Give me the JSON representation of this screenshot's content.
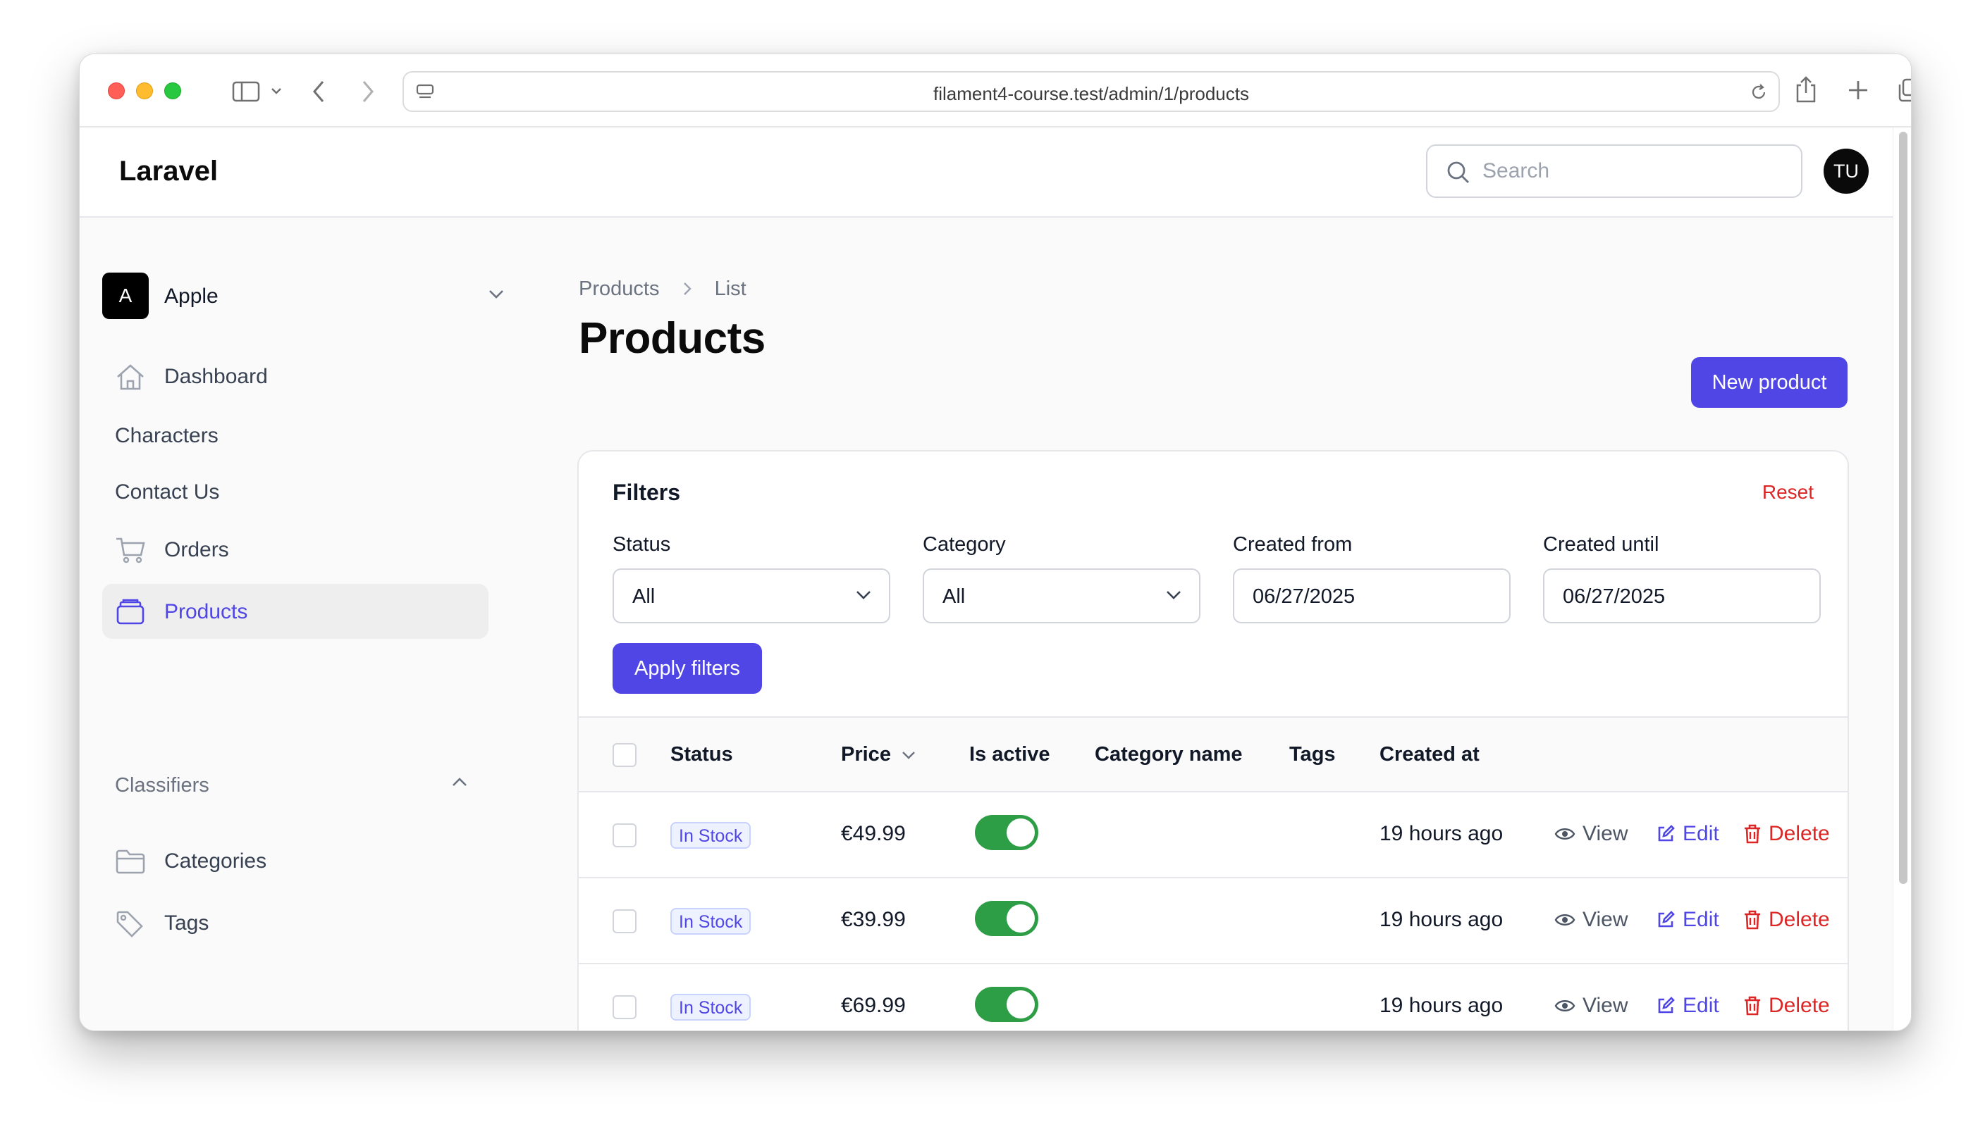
{
  "browser": {
    "url": "filament4-course.test/admin/1/products"
  },
  "header": {
    "brand": "Laravel",
    "search_placeholder": "Search",
    "avatar_initials": "TU"
  },
  "sidebar": {
    "tenant": {
      "initial": "A",
      "name": "Apple"
    },
    "items": [
      {
        "label": "Dashboard",
        "icon": "home-icon"
      },
      {
        "label": "Characters"
      },
      {
        "label": "Contact Us"
      },
      {
        "label": "Orders",
        "icon": "cart-icon"
      },
      {
        "label": "Products",
        "icon": "products-icon",
        "active": true
      }
    ],
    "group": {
      "label": "Classifiers",
      "items": [
        {
          "label": "Categories",
          "icon": "folder-icon"
        },
        {
          "label": "Tags",
          "icon": "tag-icon"
        }
      ]
    }
  },
  "page": {
    "breadcrumb": [
      "Products",
      "List"
    ],
    "title": "Products",
    "new_button": "New product"
  },
  "filters": {
    "title": "Filters",
    "reset": "Reset",
    "fields": [
      {
        "label": "Status",
        "value": "All"
      },
      {
        "label": "Category",
        "value": "All"
      },
      {
        "label": "Created from",
        "value": "06/27/2025"
      },
      {
        "label": "Created until",
        "value": "06/27/2025"
      }
    ],
    "apply": "Apply filters"
  },
  "table": {
    "columns": [
      "Status",
      "Price",
      "Is active",
      "Category name",
      "Tags",
      "Created at"
    ],
    "actions": {
      "view": "View",
      "edit": "Edit",
      "delete": "Delete"
    },
    "rows": [
      {
        "status": "In Stock",
        "price": "€49.99",
        "active": true,
        "category": "",
        "tags": "",
        "created": "19 hours ago"
      },
      {
        "status": "In Stock",
        "price": "€39.99",
        "active": true,
        "category": "",
        "tags": "",
        "created": "19 hours ago"
      },
      {
        "status": "In Stock",
        "price": "€69.99",
        "active": true,
        "category": "",
        "tags": "",
        "created": "19 hours ago"
      }
    ]
  },
  "colors": {
    "primary": "#4f46e5",
    "danger": "#dc2626",
    "toggle_on": "#2e9e46"
  }
}
